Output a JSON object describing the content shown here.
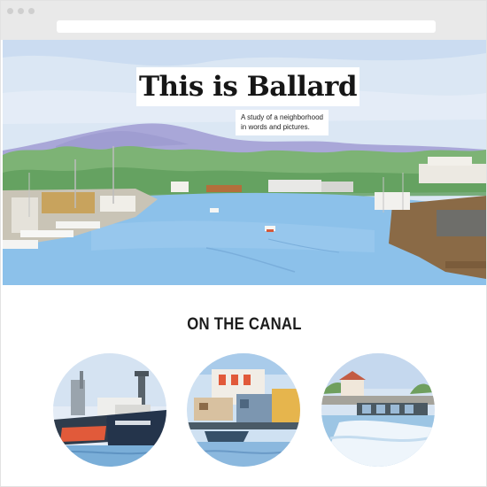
{
  "browser": {
    "window_controls": [
      "dot",
      "dot",
      "dot"
    ]
  },
  "hero": {
    "title": "This is Ballard",
    "subtitle_lines": [
      "A study of a neighborhood",
      "in words and pictures."
    ],
    "image_description_name": "ballard-canal-watercolor",
    "colors": {
      "sky": "#d9e6f4",
      "mountains": "#a9a6d6",
      "trees": "#7fb27a",
      "water": "#8cc0ea"
    }
  },
  "section": {
    "heading": "ON THE CANAL",
    "illustrations": [
      {
        "name": "fishing-boats"
      },
      {
        "name": "houseboats"
      },
      {
        "name": "locks-and-spillway"
      }
    ]
  }
}
